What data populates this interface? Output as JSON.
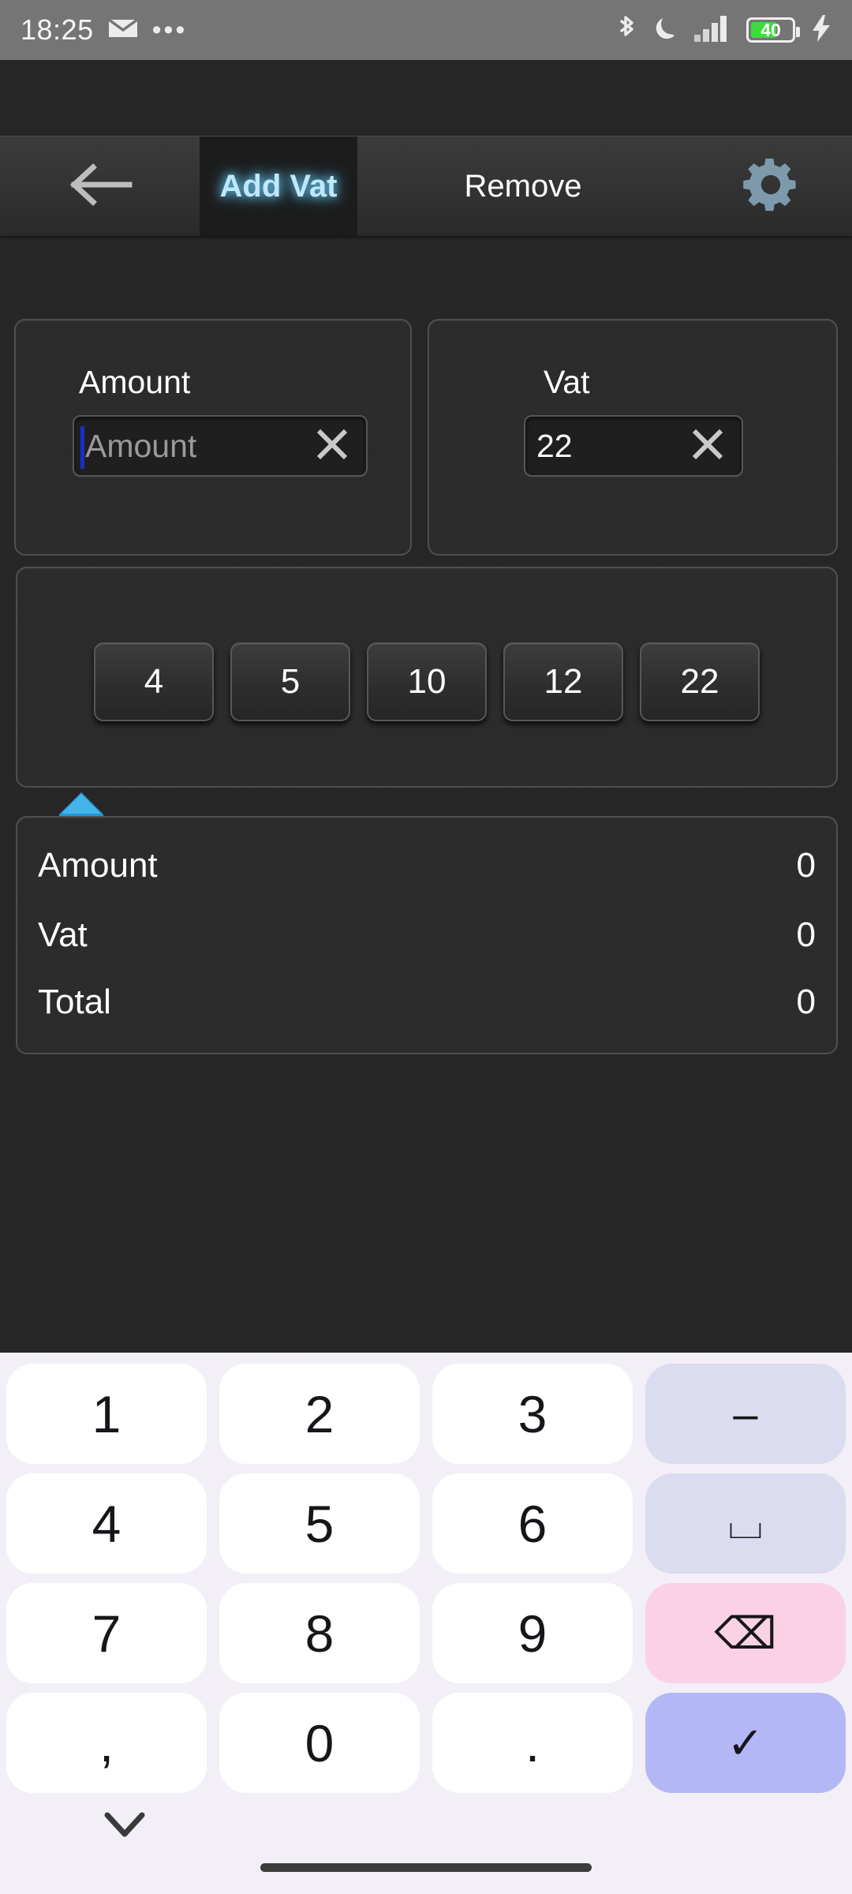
{
  "status_bar": {
    "time": "18:25",
    "mail_icon": "envelope-icon",
    "more_notifications": "•••",
    "bluetooth_icon": "bluetooth-icon",
    "dnd_icon": "moon-icon",
    "signal_icon": "signal-bars-icon",
    "battery_level": "40",
    "battery_color": "#3ddc3d",
    "charging_icon": "lightning-bolt-icon",
    "background": "#757575"
  },
  "toolbar": {
    "back_icon": "arrow-left-icon",
    "settings_icon": "gear-icon",
    "active_tab_color": "#bfe8fb",
    "tabs": [
      {
        "label": "Add Vat",
        "active": true
      },
      {
        "label": "Remove",
        "active": false
      }
    ]
  },
  "amount_field": {
    "label": "Amount",
    "placeholder": "Amount",
    "value": "",
    "clear_icon": "close-x-icon",
    "caret_color": "#1731c7",
    "handle_icon": "text-cursor-handle-icon",
    "handle_color": "#2196d4"
  },
  "vat_field": {
    "label": "Vat",
    "value": "22",
    "clear_icon": "close-x-icon"
  },
  "presets": {
    "values": [
      "4",
      "5",
      "10",
      "12",
      "22"
    ]
  },
  "results": {
    "rows": [
      {
        "label": "Amount",
        "value": "0"
      },
      {
        "label": "Vat",
        "value": "0"
      },
      {
        "label": "Total",
        "value": "0"
      }
    ]
  },
  "keyboard": {
    "background": "#f2eff6",
    "rows": [
      [
        {
          "label": "1",
          "type": "num",
          "name": "key-1"
        },
        {
          "label": "2",
          "type": "num",
          "name": "key-2"
        },
        {
          "label": "3",
          "type": "num",
          "name": "key-3"
        },
        {
          "label": "–",
          "type": "fn",
          "name": "key-minus"
        }
      ],
      [
        {
          "label": "4",
          "type": "num",
          "name": "key-4"
        },
        {
          "label": "5",
          "type": "num",
          "name": "key-5"
        },
        {
          "label": "6",
          "type": "num",
          "name": "key-6"
        },
        {
          "label": "⌴",
          "type": "fn",
          "name": "key-space"
        }
      ],
      [
        {
          "label": "7",
          "type": "num",
          "name": "key-7"
        },
        {
          "label": "8",
          "type": "num",
          "name": "key-8"
        },
        {
          "label": "9",
          "type": "num",
          "name": "key-9"
        },
        {
          "label": "⌫",
          "type": "del",
          "name": "key-backspace"
        }
      ],
      [
        {
          "label": ",",
          "type": "num",
          "name": "key-comma"
        },
        {
          "label": "0",
          "type": "num",
          "name": "key-0"
        },
        {
          "label": ".",
          "type": "num",
          "name": "key-period"
        },
        {
          "label": "✓",
          "type": "ok",
          "name": "key-enter"
        }
      ]
    ],
    "hide_icon": "chevron-down-icon",
    "home_indicator": "home-gesture-bar"
  }
}
